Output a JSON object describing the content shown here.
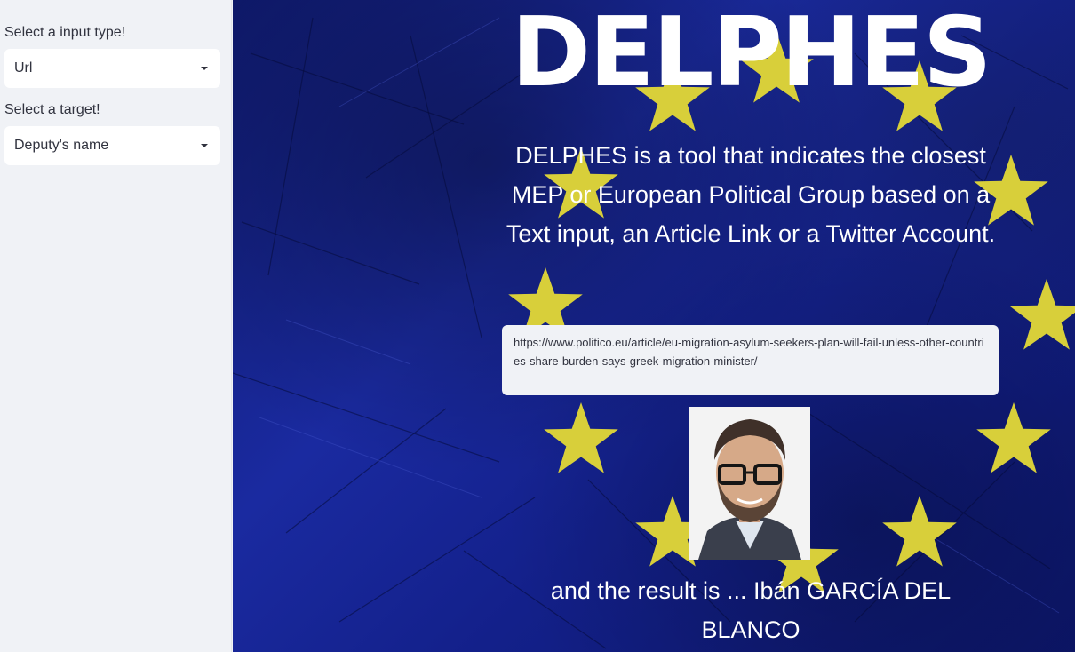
{
  "sidebar": {
    "input_type_label": "Select a input type!",
    "input_type_value": "Url",
    "target_label": "Select a target!",
    "target_value": "Deputy's name"
  },
  "main": {
    "title": "DELPHES",
    "description": "DELPHES is a tool that indicates the closest MEP or European Political Group based on a Text input, an Article Link or a Twitter Account.",
    "url_value": "https://www.politico.eu/article/eu-migration-asylum-seekers-plan-will-fail-unless-other-countries-share-burden-says-greek-migration-minister/",
    "result_text": "and the result is ... Ibán GARCÍA DEL BLANCO"
  },
  "colors": {
    "background_blue": "#1a2aa0",
    "star_yellow": "#d8cf3a",
    "sidebar_bg": "#f0f2f6"
  },
  "icons": [
    "caret-down-icon",
    "eu-star-icon"
  ]
}
